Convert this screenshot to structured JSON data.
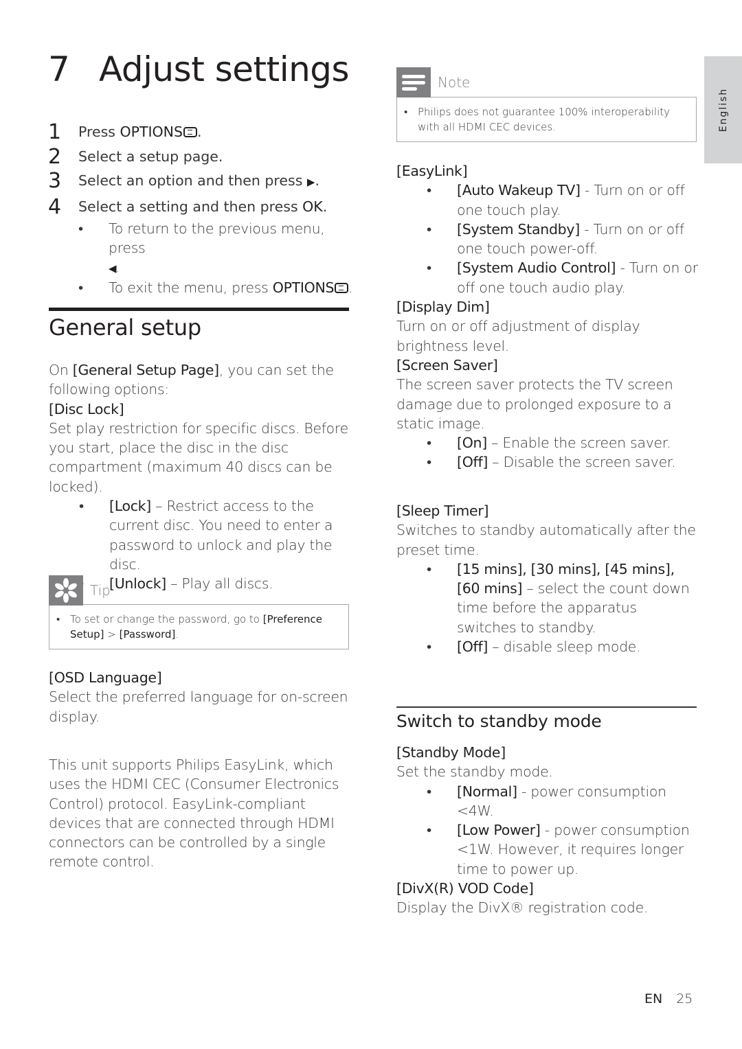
{
  "chapter": {
    "number": "7",
    "title": "Adjust settings"
  },
  "steps": [
    {
      "n": "1",
      "pre": "Press ",
      "bold": "OPTIONS",
      "icon": "options-icon",
      "post": "."
    },
    {
      "n": "2",
      "pre": "Select a setup page.",
      "bold": "",
      "post": ""
    },
    {
      "n": "3",
      "pre": "Select an option and then press ",
      "bold": "",
      "glyph": "▶",
      "post": "."
    },
    {
      "n": "4",
      "pre": "Select a setting and then press ",
      "bold": "OK",
      "post": "."
    }
  ],
  "step_bullets": [
    {
      "text": "To return to the previous menu, press",
      "line2": "◀."
    },
    {
      "pre": "To exit the menu, press ",
      "bold": "OPTIONS",
      "icon": "options-icon",
      "post": "."
    }
  ],
  "general_setup": {
    "heading": "General setup",
    "intro_pre": "On ",
    "intro_bold": "[General Setup Page]",
    "intro_post": ", you can set the following options:",
    "disc_lock": {
      "title": "[Disc Lock]",
      "desc": "Set play restriction for specific discs. Before you start, place the disc in the disc compartment (maximum 40 discs can be locked).",
      "options": [
        {
          "name": "[Lock]",
          "desc": " – Restrict access to the current disc. You need to enter a password to unlock and play the disc."
        },
        {
          "name": "[Unlock]",
          "desc": " – Play all discs."
        }
      ]
    },
    "tip": {
      "label": "Tip",
      "icon": "tip-asterisk-icon",
      "pre": "To set or change the password, go to ",
      "bold1": "[Preference Setup]",
      "mid": " > ",
      "bold2": "[Password]",
      "post": "."
    },
    "osd_language": {
      "title": "[OSD Language]",
      "desc": "Select the preferred language for on-screen display."
    },
    "easylink_intro": "This unit supports Philips EasyLink, which uses the HDMI CEC (Consumer Electronics Control) protocol. EasyLink-compliant devices that are connected through HDMI connectors can be controlled by a single remote control."
  },
  "note": {
    "label": "Note",
    "icon": "note-lines-icon",
    "text": "Philips does not guarantee 100% interoperability with all HDMI CEC devices."
  },
  "easylink": {
    "title": "[EasyLink]",
    "options": [
      {
        "name": "[Auto Wakeup TV]",
        "desc": " - Turn on or off one touch play."
      },
      {
        "name": "[System Standby]",
        "desc": " - Turn on or off one touch power-off."
      },
      {
        "name": "[System Audio Control]",
        "desc": " - Turn on or off one touch audio play."
      }
    ]
  },
  "display_dim": {
    "title": "[Display Dim]",
    "desc": "Turn on or off adjustment of display brightness level."
  },
  "screen_saver": {
    "title": "[Screen Saver]",
    "desc": "The screen saver protects the TV screen damage due to prolonged exposure to a static image.",
    "options": [
      {
        "name": "[On]",
        "desc": " – Enable the screen saver."
      },
      {
        "name": "[Off]",
        "desc": " – Disable the screen saver."
      }
    ]
  },
  "sleep_timer": {
    "title": "[Sleep Timer]",
    "desc": "Switches to standby automatically after the preset time.",
    "options": [
      {
        "name": "[15 mins], [30 mins], [45 mins], [60 mins]",
        "desc": " – select the count down time before the apparatus switches to standby."
      },
      {
        "name": "[Off]",
        "desc": " – disable sleep mode."
      }
    ]
  },
  "standby": {
    "heading": "Switch to standby mode",
    "mode_title": "[Standby Mode]",
    "mode_desc": "Set the standby mode.",
    "options": [
      {
        "name": "[Normal]",
        "desc": " - power consumption <4W."
      },
      {
        "name": "[Low Power]",
        "desc": " - power consumption <1W. However, it requires longer time to power up."
      }
    ],
    "divx_title": "[DivX(R) VOD Code]",
    "divx_desc": "Display the DivX® registration code."
  },
  "side_tab": {
    "label": "English"
  },
  "footer": {
    "lang": "EN",
    "page": "25"
  }
}
